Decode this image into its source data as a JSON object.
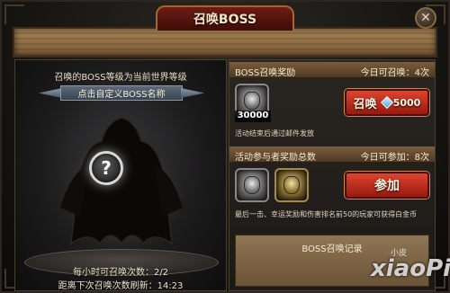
{
  "window": {
    "title": "召唤BOSS",
    "close_icon": "close-x-icon"
  },
  "summon_area": {
    "level_note": "召唤的BOSS等级为当前世界等级",
    "custom_name_button": "点击自定义BOSS名称",
    "unknown_boss_symbol": "?",
    "hourly_summons": "每小时可召唤次数：2/2",
    "next_refresh": "距离下次召唤次数刷新：14:23"
  },
  "boss_reward": {
    "heading": "BOSS召唤奖励",
    "today_remaining": "今日可召唤：4次",
    "item_count": "30000",
    "note": "活动结束后通过邮件发放",
    "summon_button": "召唤",
    "summon_cost": "5000",
    "cost_icon": "diamond-gem-icon"
  },
  "participant_reward": {
    "heading": "活动参与者奖励总数",
    "today_remaining": "今日可参加：8次",
    "note": "最后一击、幸运奖励和伤害排名前50的玩家可获得白金币",
    "join_button": "参加"
  },
  "records": {
    "title": "BOSS召唤记录"
  },
  "watermark": {
    "main": "xiaoPi",
    "sub": "小皮"
  },
  "colors": {
    "accent_red": "#c0301f",
    "wood": "#8f7554",
    "panel_dark": "#1c1916"
  }
}
